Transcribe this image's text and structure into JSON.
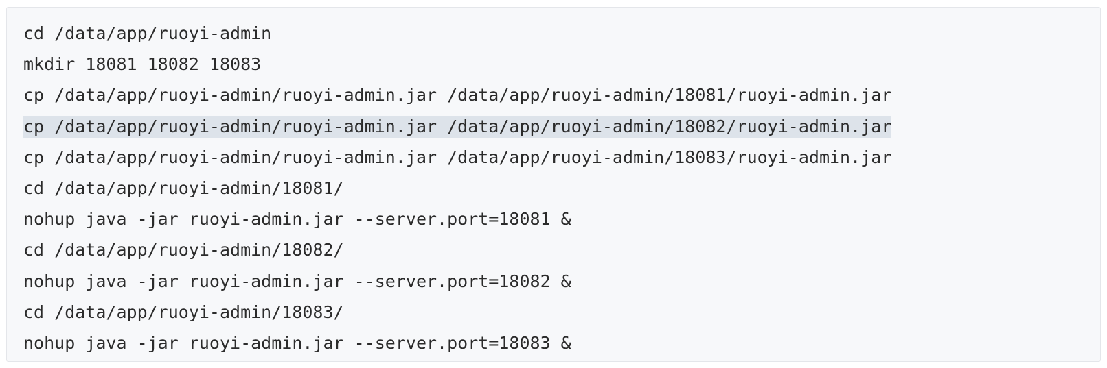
{
  "code_block": {
    "lines": [
      {
        "text": "cd /data/app/ruoyi-admin",
        "highlighted": false
      },
      {
        "text": "mkdir 18081 18082 18083",
        "highlighted": false
      },
      {
        "text": "cp /data/app/ruoyi-admin/ruoyi-admin.jar /data/app/ruoyi-admin/18081/ruoyi-admin.jar",
        "highlighted": false
      },
      {
        "text": "cp /data/app/ruoyi-admin/ruoyi-admin.jar /data/app/ruoyi-admin/18082/ruoyi-admin.jar",
        "highlighted": true
      },
      {
        "text": "cp /data/app/ruoyi-admin/ruoyi-admin.jar /data/app/ruoyi-admin/18083/ruoyi-admin.jar",
        "highlighted": false
      },
      {
        "text": "cd /data/app/ruoyi-admin/18081/",
        "highlighted": false
      },
      {
        "text": "nohup java -jar ruoyi-admin.jar --server.port=18081 &",
        "highlighted": false
      },
      {
        "text": "cd /data/app/ruoyi-admin/18082/",
        "highlighted": false
      },
      {
        "text": "nohup java -jar ruoyi-admin.jar --server.port=18082 &",
        "highlighted": false
      },
      {
        "text": "cd /data/app/ruoyi-admin/18083/",
        "highlighted": false
      },
      {
        "text": "nohup java -jar ruoyi-admin.jar --server.port=18083 &",
        "highlighted": false
      }
    ]
  }
}
